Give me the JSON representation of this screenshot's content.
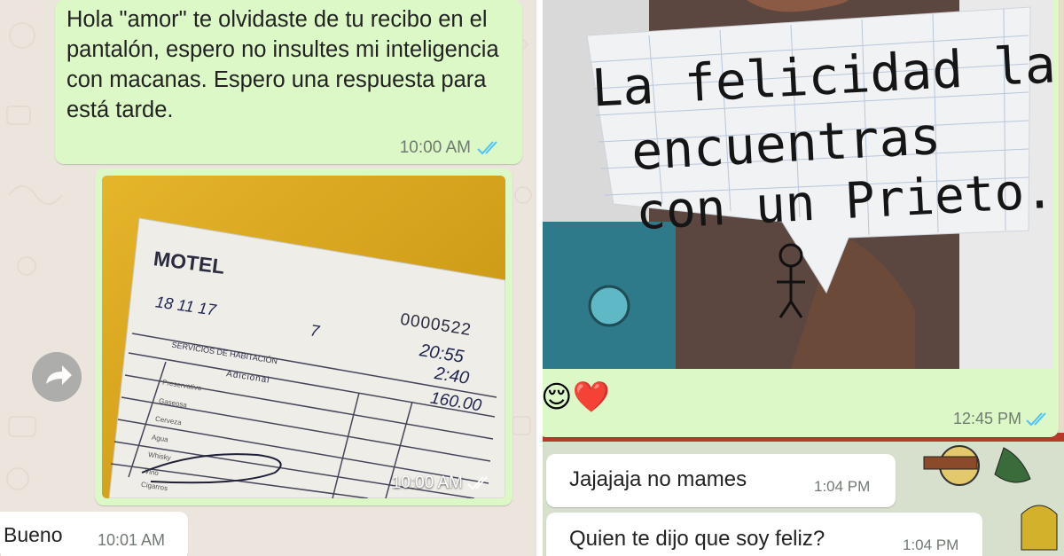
{
  "left_chat": {
    "msg1": {
      "text": "Hola \"amor\" te olvidaste de tu recibo en el pantalón, espero no insultes mi inteligencia con macanas. Espero una respuesta para está tarde.",
      "time": "10:00 AM"
    },
    "photo_msg": {
      "time": "10:00 AM",
      "receipt": {
        "title": "MOTEL",
        "number": "0000522",
        "date": "18 11 17",
        "room": "7",
        "hora": "20:55",
        "transcurrido": "2:40",
        "precio": "160.00",
        "header": "SERVICIOS DE HABITACIÓN",
        "adicional": "Adicional",
        "items": [
          "Preservativo",
          "Gaseosa",
          "Cerveza",
          "Agua",
          "Whisky",
          "Vino",
          "Cigarros"
        ]
      }
    },
    "msg2": {
      "text": "Bueno",
      "time": "10:01 AM"
    }
  },
  "right_chat": {
    "photo_msg": {
      "sign_lines": [
        "La felicidad la",
        "encuentras",
        "con un Prieto."
      ],
      "emojis": "😌❤️",
      "time": "12:45 PM"
    },
    "msg1": {
      "text": "Jajajaja no mames",
      "time": "1:04 PM"
    },
    "msg2": {
      "text": "Quien te dijo que soy feliz?",
      "time": "1:04 PM"
    }
  },
  "colors": {
    "outgoing": "#dcf8c6",
    "incoming": "#ffffff",
    "read_ticks": "#4fc3f7",
    "left_wallpaper": "#ece5dd"
  },
  "icons": [
    "forward-icon",
    "double-check-icon"
  ]
}
